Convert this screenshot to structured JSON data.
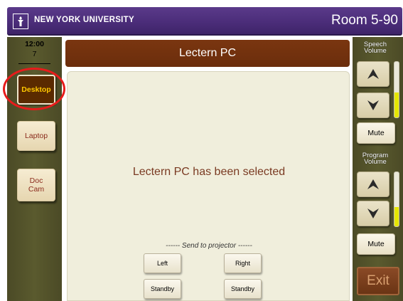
{
  "header": {
    "org_name": "NEW YORK UNIVERSITY",
    "room": "Room 5-90",
    "logo_icon": "torch-icon"
  },
  "clock": {
    "time": "12:00",
    "date": "7"
  },
  "sources": [
    {
      "label": "Desktop",
      "active": true
    },
    {
      "label": "Laptop",
      "active": false
    },
    {
      "label": "Doc Cam",
      "active": false
    }
  ],
  "main": {
    "title": "Lectern PC",
    "status": "Lectern PC has been selected",
    "send_label": "------ Send to projector ------",
    "projector_buttons": {
      "left": "Left",
      "right": "Right",
      "standby_left": "Standby",
      "standby_right": "Standby"
    }
  },
  "speech_volume": {
    "label_line1": "Speech",
    "label_line2": "Volume",
    "up_icon": "arrow-up-icon",
    "down_icon": "arrow-down-icon",
    "mute": "Mute",
    "level": 0.45
  },
  "program_volume": {
    "label_line1": "Program",
    "label_line2": "Volume",
    "up_icon": "arrow-up-icon",
    "down_icon": "arrow-down-icon",
    "mute": "Mute",
    "level": 0.35
  },
  "exit": "Exit",
  "colors": {
    "header": "#4a2c78",
    "title_bar": "#6b2d0c",
    "sidebar": "#5a5a2e",
    "active_source_bg": "#5a2a00",
    "active_source_text": "#ffc800",
    "highlight_ring": "#e81b1b",
    "status_text": "#7a3a22",
    "meter_fill": "#e6e600"
  }
}
